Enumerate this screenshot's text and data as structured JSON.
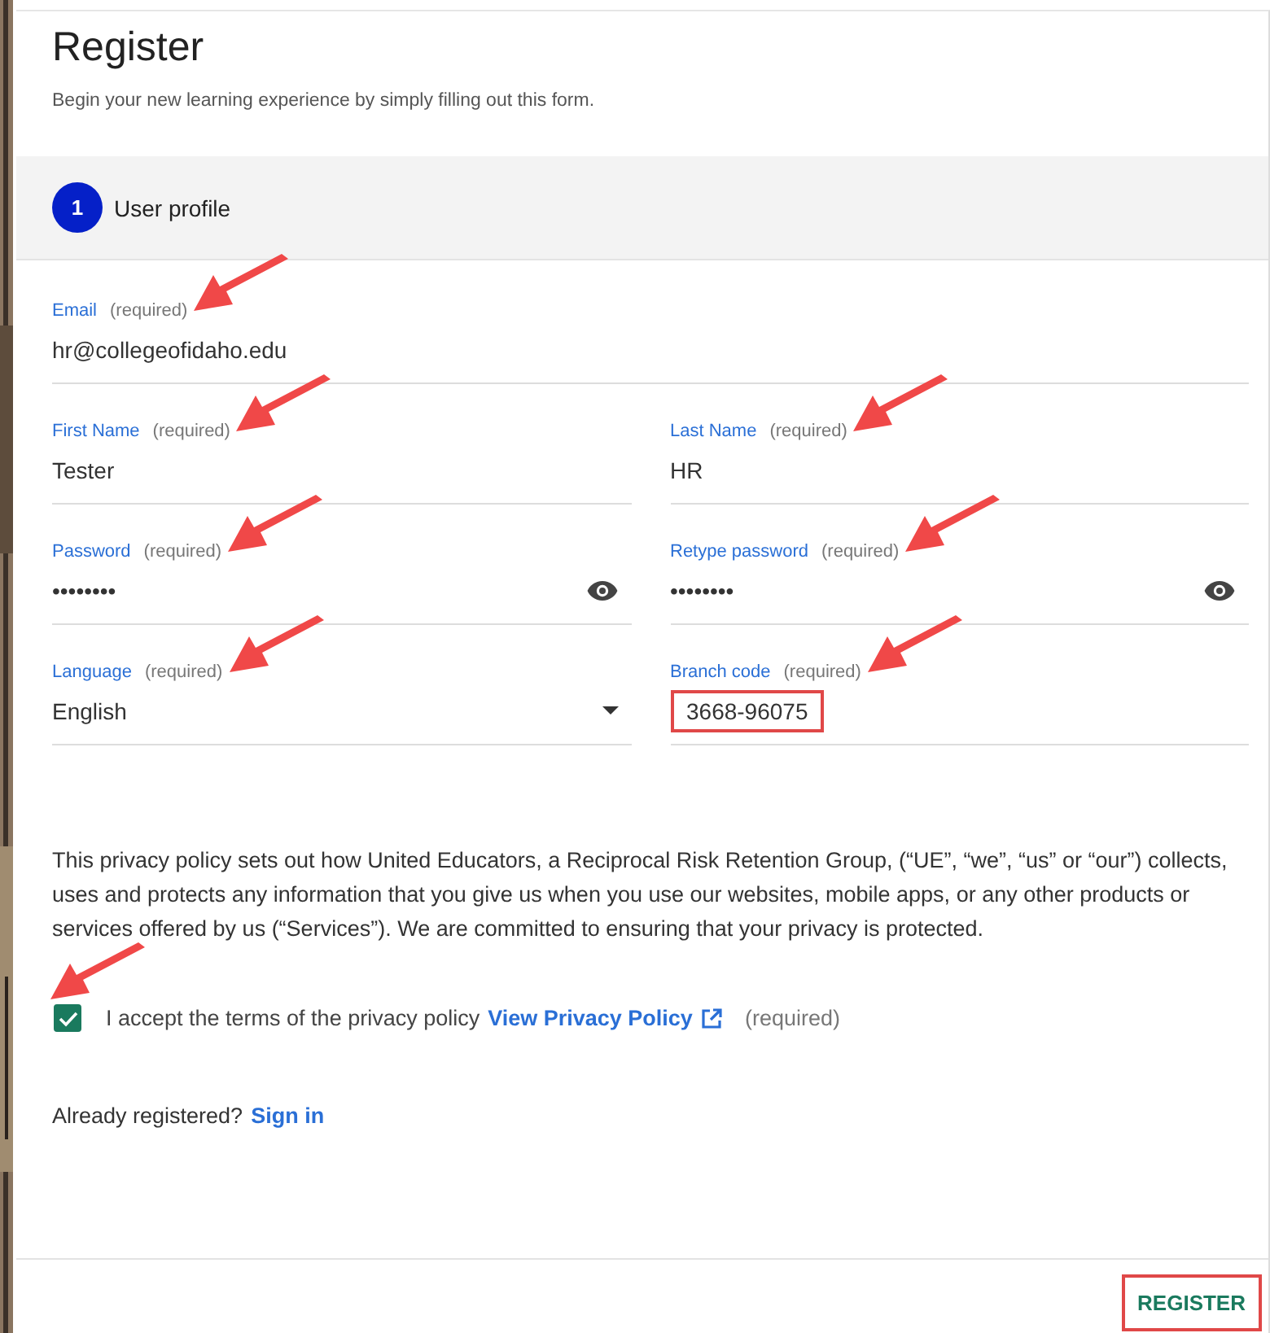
{
  "header": {
    "title": "Register",
    "subtitle": "Begin your new learning experience by simply filling out this form."
  },
  "step": {
    "number": "1",
    "label": "User profile"
  },
  "rows": [
    {
      "fields": [
        {
          "kind": "text",
          "label": "Email",
          "hint": "(required)",
          "value": "hr@collegeofidaho.edu",
          "arrow": true,
          "highlighted": false
        }
      ]
    },
    {
      "fields": [
        {
          "kind": "text",
          "label": "First Name",
          "hint": "(required)",
          "value": "Tester",
          "arrow": true,
          "highlighted": false
        },
        {
          "kind": "text",
          "label": "Last Name",
          "hint": "(required)",
          "value": "HR",
          "arrow": true,
          "highlighted": false
        }
      ]
    },
    {
      "fields": [
        {
          "kind": "password",
          "label": "Password",
          "hint": "(required)",
          "value": "••••••••",
          "arrow": true,
          "highlighted": false
        },
        {
          "kind": "password",
          "label": "Retype password",
          "hint": "(required)",
          "value": "••••••••",
          "arrow": true,
          "highlighted": false
        }
      ]
    },
    {
      "fields": [
        {
          "kind": "select",
          "label": "Language",
          "hint": "(required)",
          "value": "English",
          "arrow": true,
          "highlighted": false
        },
        {
          "kind": "text",
          "label": "Branch code",
          "hint": "(required)",
          "value": "3668-96075",
          "arrow": true,
          "highlighted": true
        }
      ]
    }
  ],
  "privacy_text": "This privacy policy sets out how United Educators, a Reciprocal Risk Retention Group, (“UE”, “we”, “us” or “our”) collects, uses and protects any information that you give us when you use our websites, mobile apps, or any other products or services offered by us (“Services”). We are committed to ensuring that your privacy is protected.",
  "consent": {
    "checked": true,
    "arrow": true,
    "label": "I accept the terms of the privacy policy",
    "link": "View Privacy Policy",
    "hint": "(required)"
  },
  "signin": {
    "prompt": "Already registered?",
    "link": "Sign in"
  },
  "register_button": {
    "label": "REGISTER",
    "highlighted": true
  }
}
